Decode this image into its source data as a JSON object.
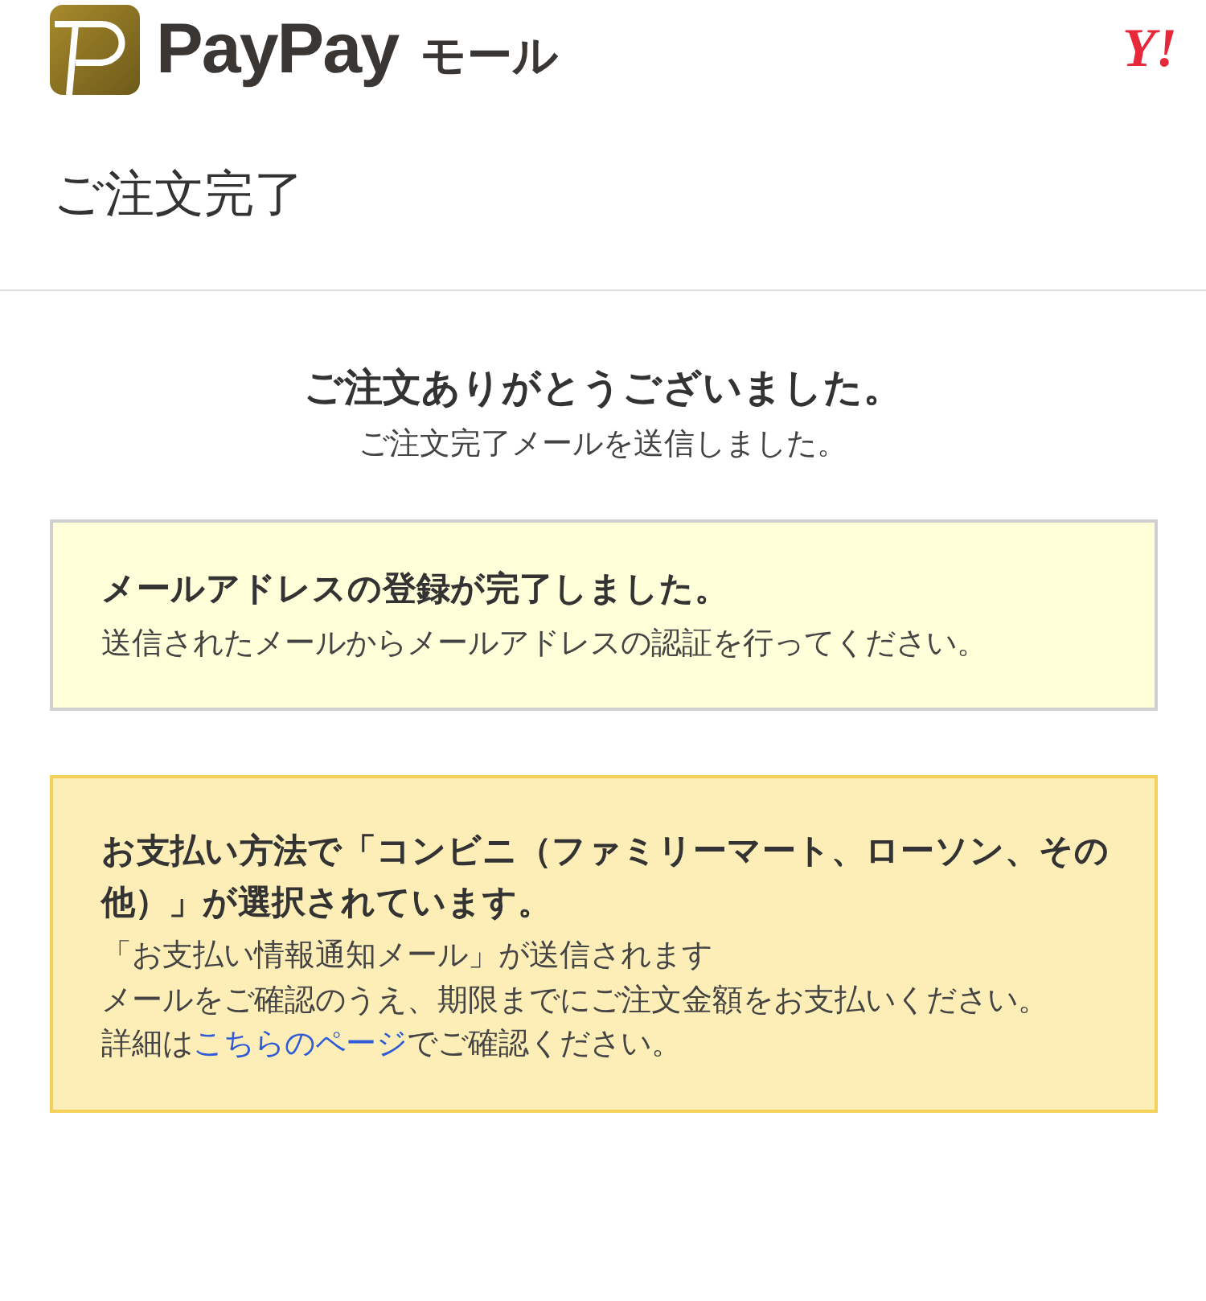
{
  "header": {
    "logo_text": "PayPay",
    "logo_suffix": "モール",
    "partner_logo": "Y!"
  },
  "page_title": "ご注文完了",
  "thanks": {
    "heading": "ご注文ありがとうございました。",
    "subtitle": "ご注文完了メールを送信しました。"
  },
  "notices": [
    {
      "kind": "info",
      "title": "メールアドレスの登録が完了しました。",
      "lines": [
        "送信されたメールからメールアドレスの認証を行ってください。"
      ]
    },
    {
      "kind": "warning",
      "title": "お支払い方法で「コンビニ（ファミリーマート、ローソン、その他）」が選択されています。",
      "lines": [
        "「お支払い情報通知メール」が送信されます",
        "メールをご確認のうえ、期限までにご注文金額をお支払いください。"
      ],
      "link_line": {
        "before": "詳細は",
        "link": "こちらのページ",
        "after": "でご確認ください。"
      }
    }
  ]
}
